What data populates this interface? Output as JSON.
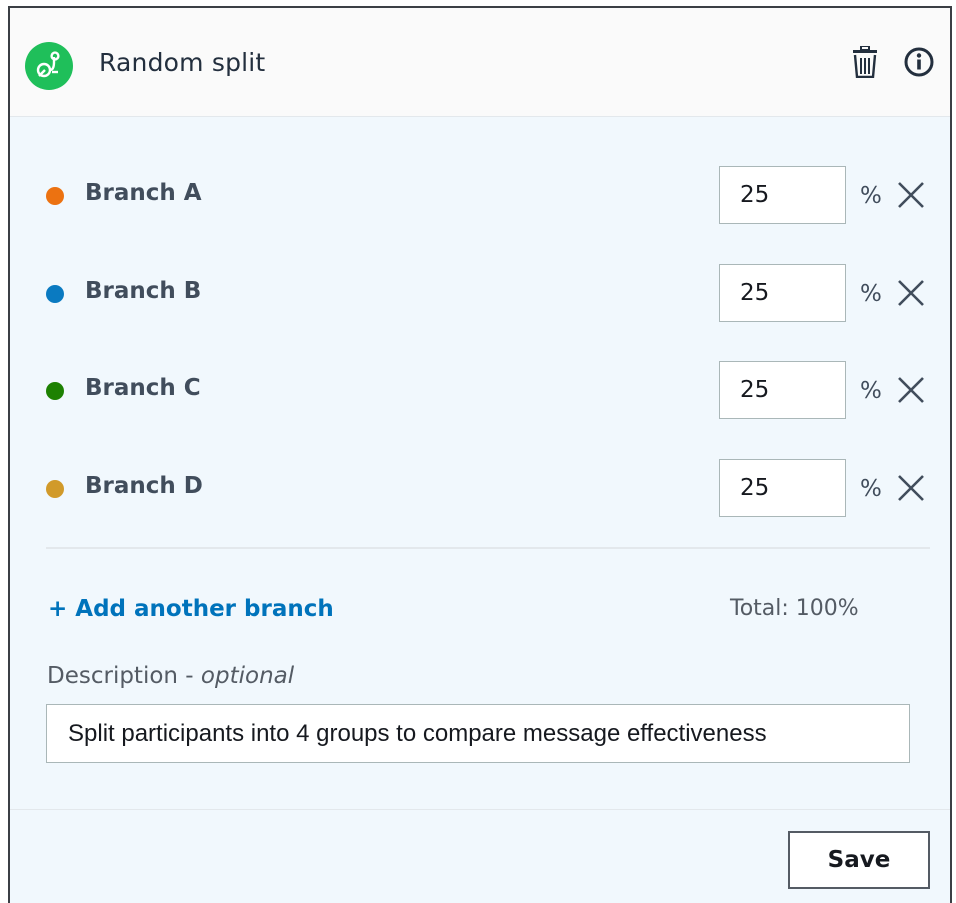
{
  "header": {
    "title": "Random split",
    "app_icon": "split-icon",
    "app_icon_color": "#1fbf5a",
    "actions": [
      "trash-icon",
      "info-icon"
    ]
  },
  "branches": [
    {
      "label": "Branch A",
      "value": "25",
      "color": "#ec7211"
    },
    {
      "label": "Branch B",
      "value": "25",
      "color": "#0a7ac1"
    },
    {
      "label": "Branch C",
      "value": "25",
      "color": "#1d8102"
    },
    {
      "label": "Branch D",
      "value": "25",
      "color": "#d19a2a"
    }
  ],
  "percent_sign": "%",
  "add_branch_label": "+ Add another branch",
  "total_label": "Total: 100%",
  "description": {
    "label": "Description - ",
    "optional": "optional",
    "value": "Split participants into 4 groups to compare message effectiveness"
  },
  "footer": {
    "save_label": "Save"
  },
  "colors": {
    "link": "#0073bb",
    "panel_bg": "#f1f8fd"
  }
}
